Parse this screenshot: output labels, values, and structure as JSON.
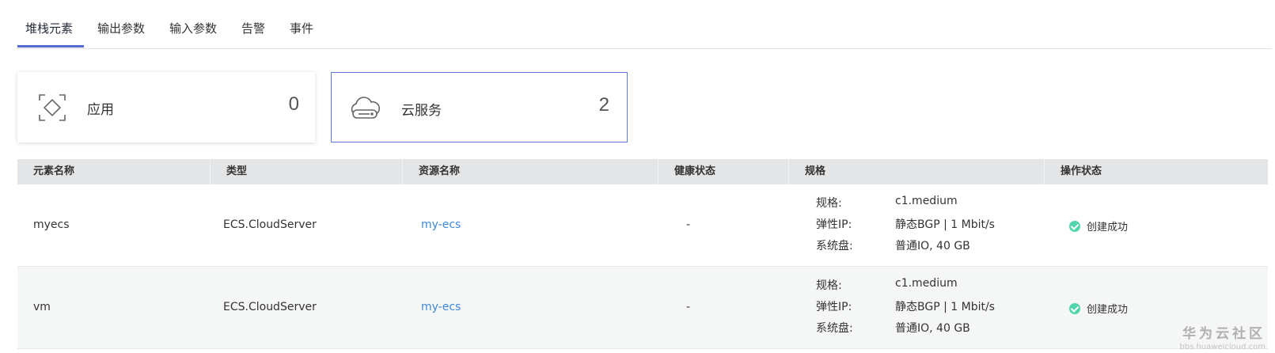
{
  "tabs": [
    {
      "label": "堆栈元素",
      "active": true
    },
    {
      "label": "输出参数",
      "active": false
    },
    {
      "label": "输入参数",
      "active": false
    },
    {
      "label": "告警",
      "active": false
    },
    {
      "label": "事件",
      "active": false
    }
  ],
  "cards": {
    "app": {
      "label": "应用",
      "count": "0",
      "icon": "application-icon"
    },
    "cloud": {
      "label": "云服务",
      "count": "2",
      "icon": "cloud-icon",
      "selected": true
    }
  },
  "table": {
    "headers": [
      "元素名称",
      "类型",
      "资源名称",
      "健康状态",
      "规格",
      "操作状态"
    ],
    "rows": [
      {
        "name": "myecs",
        "type": "ECS.CloudServer",
        "resource": "my-ecs",
        "health": "-",
        "spec": [
          {
            "key": "规格:",
            "value": "c1.medium"
          },
          {
            "key": "弹性IP:",
            "value": "静态BGP | 1 Mbit/s"
          },
          {
            "key": "系统盘:",
            "value": "普通IO, 40 GB"
          }
        ],
        "status": "创建成功"
      },
      {
        "name": "vm",
        "type": "ECS.CloudServer",
        "resource": "my-ecs",
        "health": "-",
        "spec": [
          {
            "key": "规格:",
            "value": "c1.medium"
          },
          {
            "key": "弹性IP:",
            "value": "静态BGP | 1 Mbit/s"
          },
          {
            "key": "系统盘:",
            "value": "普通IO, 40 GB"
          }
        ],
        "status": "创建成功"
      }
    ]
  },
  "colors": {
    "accent": "#526ecc",
    "link": "#3f88d8",
    "success": "#50d4ab"
  },
  "watermark": {
    "title": "华为云社区",
    "url": "bbs.huaweicloud.com"
  }
}
